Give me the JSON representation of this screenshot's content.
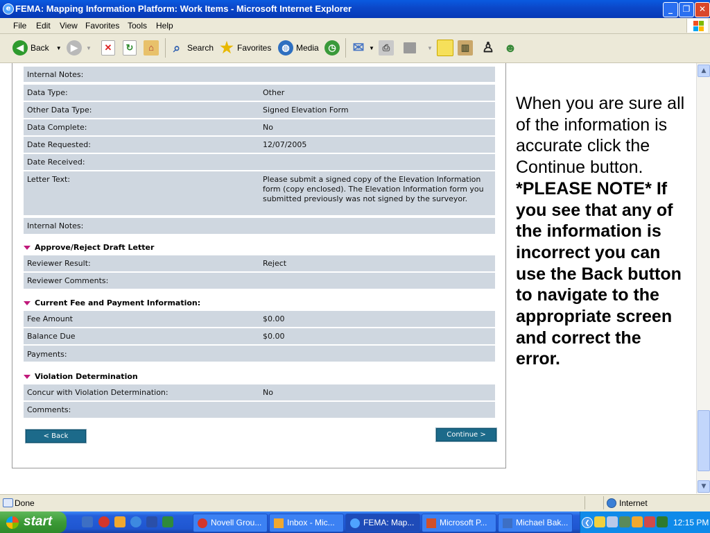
{
  "window": {
    "title": "FEMA: Mapping Information Platform: Work Items - Microsoft Internet Explorer"
  },
  "menu": [
    "File",
    "Edit",
    "View",
    "Favorites",
    "Tools",
    "Help"
  ],
  "toolbar": {
    "back": "Back",
    "search": "Search",
    "favorites": "Favorites",
    "media": "Media"
  },
  "top_rows": [
    {
      "label": "Internal Notes:",
      "value": ""
    },
    {
      "label": "Data Type:",
      "value": "Other"
    },
    {
      "label": "Other Data Type:",
      "value": "Signed Elevation Form"
    },
    {
      "label": "Data Complete:",
      "value": "No"
    },
    {
      "label": "Date Requested:",
      "value": "12/07/2005"
    },
    {
      "label": "Date Received:",
      "value": ""
    },
    {
      "label": "Letter Text:",
      "value": "Please submit a signed copy of the Elevation Information form (copy enclosed). The Elevation Information form you submitted previously was not signed by the surveyor."
    },
    {
      "label": "Internal Notes:",
      "value": ""
    }
  ],
  "sections": {
    "approve": {
      "title": "Approve/Reject Draft Letter",
      "rows": [
        {
          "label": "Reviewer Result:",
          "value": "Reject"
        },
        {
          "label": "Reviewer Comments:",
          "value": ""
        }
      ]
    },
    "fee": {
      "title": "Current Fee and Payment Information:",
      "rows": [
        {
          "label": "Fee Amount",
          "value": "$0.00"
        },
        {
          "label": "Balance Due",
          "value": "$0.00"
        },
        {
          "label": "Payments:",
          "value": ""
        }
      ]
    },
    "violation": {
      "title": "Violation Determination",
      "rows": [
        {
          "label": "Concur with Violation Determination:",
          "value": "No"
        },
        {
          "label": "Comments:",
          "value": ""
        }
      ]
    }
  },
  "buttons": {
    "back": "< Back",
    "continue": "Continue >"
  },
  "instructions": {
    "normal": "When you are sure all of the information is accurate click the Continue button.",
    "bold": "*PLEASE NOTE* If you see that any of the information is incorrect you can use the Back button to navigate to the appropriate screen and correct the error."
  },
  "status": {
    "left": "Done",
    "zone": "Internet"
  },
  "taskbar": {
    "start": "start",
    "tasks": [
      "Novell Grou...",
      "Inbox - Mic...",
      "FEMA: Map...",
      "Microsoft P...",
      "Michael Bak..."
    ],
    "clock": "12:15 PM"
  },
  "colors": {
    "row_bg": "#cfd7e0",
    "section_marker": "#c0187a",
    "button_bg": "#1c6a8a",
    "title_bar": "#0b47c8"
  }
}
